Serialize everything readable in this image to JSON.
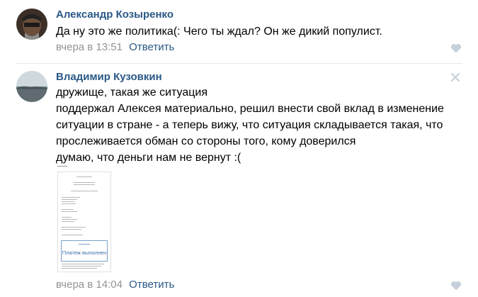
{
  "comments": [
    {
      "author": "Александр Козыренко",
      "text_lines": [
        "Да ну это же политика(: Чего ты ждал? Он же дикий популист."
      ],
      "time": "вчера в 13:51",
      "reply_label": "Ответить",
      "avatar_icon": "user-avatar-icon",
      "like_icon": "heart-icon"
    },
    {
      "author": "Владимир Кузовкин",
      "text_lines": [
        "дружище, такая же ситуация",
        "поддержал Алексея материально, решил внести свой вклад в изменение",
        "ситуации в стране - а теперь вижу, что ситуация складывается такая, что",
        "прослеживается обман со стороны того, кому доверился",
        "думаю, что деньги нам не вернут :("
      ],
      "time": "вчера в 14:04",
      "reply_label": "Ответить",
      "avatar_icon": "landscape-avatar-icon",
      "like_icon": "heart-icon",
      "close_icon": "close-icon",
      "attachment": {
        "stamp_text": "Платеж выполнен"
      }
    }
  ],
  "colors": {
    "link": "#2a5885",
    "meta": "#939393",
    "icon": "#c5d0db"
  }
}
